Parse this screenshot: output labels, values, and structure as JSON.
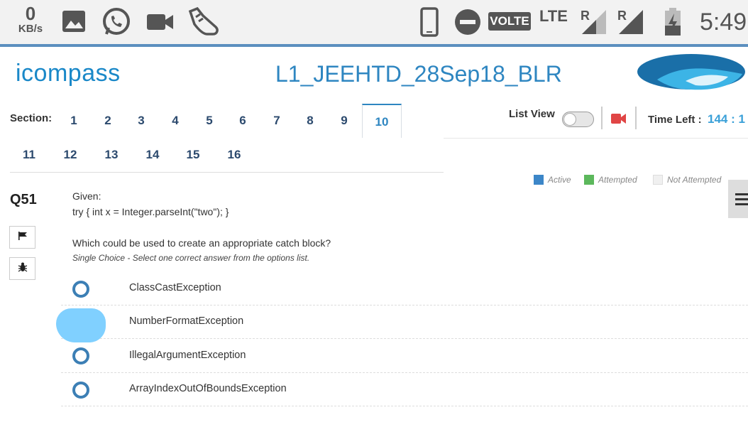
{
  "status_bar": {
    "speed_value": "0",
    "speed_unit": "KB/s",
    "network_badge": "VOLTE",
    "network_type": "LTE",
    "roaming_1": "R",
    "roaming_2": "R",
    "time": "5:49",
    "icons": [
      "gallery-icon",
      "whatsapp-icon",
      "video-call-icon",
      "sneaker-icon",
      "phone-icon",
      "do-not-disturb-icon",
      "signal-icon",
      "battery-charging-icon"
    ]
  },
  "header": {
    "logo_text": "icompass",
    "test_title": "L1_JEEHTD_28Sep18_BLR"
  },
  "sections": {
    "label": "Section:",
    "items": [
      "1",
      "2",
      "3",
      "4",
      "5",
      "6",
      "7",
      "8",
      "9",
      "10",
      "11",
      "12",
      "13",
      "14",
      "15",
      "16"
    ],
    "active": "10"
  },
  "controls": {
    "list_view_label": "List View",
    "list_view_on": false,
    "time_left_label": "Time Left :",
    "time_left_value": "144 : 1"
  },
  "legend": {
    "active": "Active",
    "attempted": "Attempted",
    "not_attempted": "Not Attempted",
    "colors": {
      "active": "#3c86c8",
      "attempted": "#5cb85c",
      "not_attempted": "#f0f0f0"
    }
  },
  "question": {
    "number": "Q51",
    "line1": "Given:",
    "line2": "try { int x = Integer.parseInt(\"two\"); }",
    "prompt": "Which could be used to create an appropriate catch block?",
    "hint": "Single Choice - Select one correct answer from the options list.",
    "options": [
      "ClassCastException",
      "NumberFormatException",
      "IllegalArgumentException",
      "ArrayIndexOutOfBoundsException"
    ]
  }
}
